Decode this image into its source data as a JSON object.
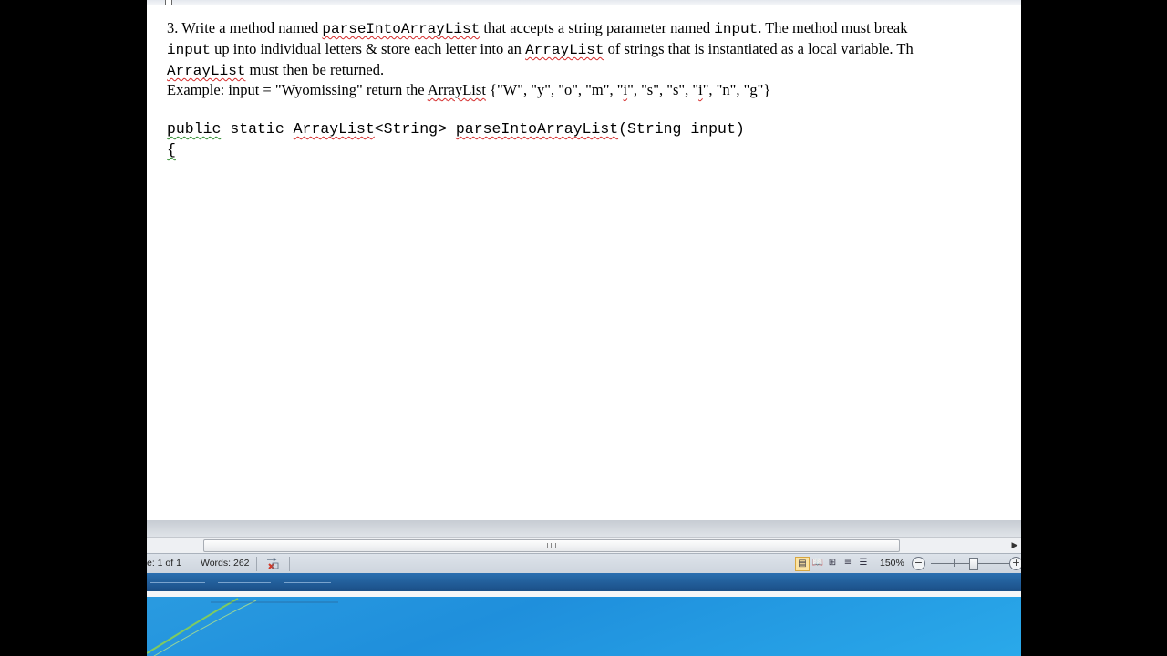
{
  "document": {
    "paragraph": {
      "l1_a": "3. Write a method named ",
      "l1_method": "parseIntoArrayList",
      "l1_b": " that accepts a string parameter named ",
      "l1_param": "input",
      "l1_c": ". The method must break",
      "l2_param": "input",
      "l2_a": " up into individual letters & store each letter into an ",
      "l2_type": "ArrayList",
      "l2_b": " of strings that is instantiated as a local variable. Th",
      "l3_type": "ArrayList",
      "l3_a": " must then be returned."
    },
    "example": {
      "prefix": "Example: input = \"Wyomissing\"     return the ",
      "type": "ArrayList",
      "list_a": "   {\"W\", \"y\", \"o\", \"m\", \"",
      "i1": "i",
      "list_b": "\", \"s\", \"s\", \"",
      "i2": "i",
      "list_c": "\", \"n\", \"g\"}"
    },
    "code": {
      "kw_public": "public",
      "static_part": " static ",
      "return_type": "ArrayList",
      "generic": "<String> ",
      "method_name": "parseIntoArrayList",
      "params": "(String input)",
      "open_brace": "{"
    }
  },
  "statusbar": {
    "page": "e: 1 of 1",
    "words": "Words: 262",
    "zoom": "150%"
  },
  "icons": {
    "proofing": "proofing-error-icon",
    "print_layout": "print-layout-icon",
    "full_screen_reading": "full-screen-reading-icon",
    "web_layout": "web-layout-icon",
    "outline": "outline-icon",
    "draft": "draft-icon"
  },
  "colors": {
    "spell_underline": "#d42a2a",
    "grammar_underline": "#2d8a2d",
    "taskbar": "#1b4f86",
    "desktop": "#1f8fdc"
  }
}
